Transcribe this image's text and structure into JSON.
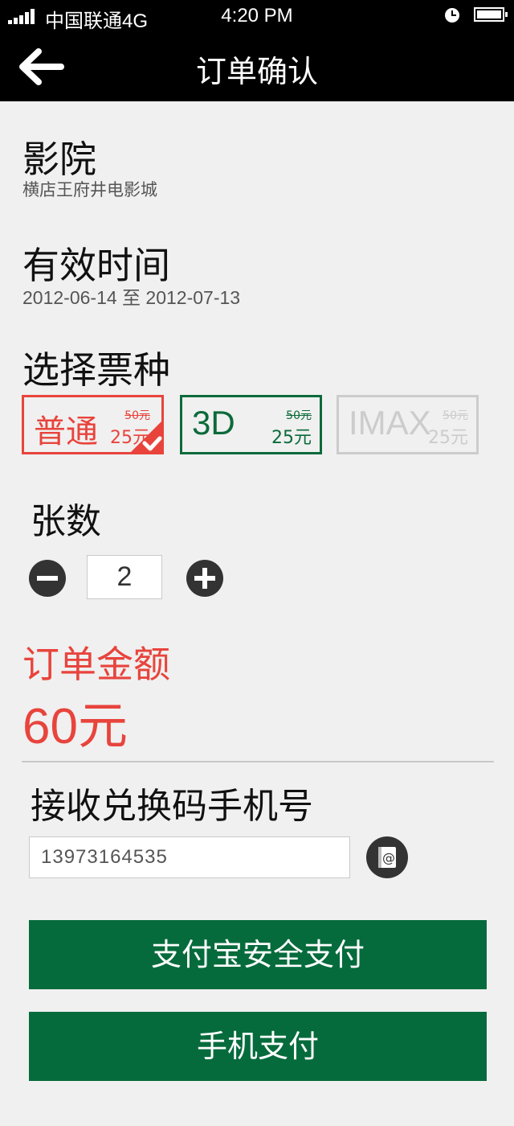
{
  "status_bar": {
    "carrier": "中国联通4G",
    "time": "4:20 PM",
    "alarm_icon": "clock-icon",
    "battery_icon": "battery-icon",
    "signal_icon": "signal-icon"
  },
  "nav": {
    "title": "订单确认",
    "back_icon": "arrow-left-icon"
  },
  "cinema": {
    "label": "影院",
    "value": "横店王府井电影城"
  },
  "validity": {
    "label": "有效时间",
    "value": "2012-06-14 至 2012-07-13"
  },
  "ticket_type": {
    "label": "选择票种",
    "options": [
      {
        "name": "普通",
        "old_price": "50元",
        "price": "25元",
        "selected": true
      },
      {
        "name": "3D",
        "old_price": "50元",
        "price": "25元",
        "selected": false
      },
      {
        "name": "IMAX",
        "old_price": "50元",
        "price": "25元",
        "selected": false,
        "disabled": true
      }
    ]
  },
  "quantity": {
    "label": "张数",
    "value": "2"
  },
  "order_total": {
    "label": "订单金额",
    "value": "60元"
  },
  "phone": {
    "label": "接收兑换码手机号",
    "value": "13973164535",
    "contact_icon": "contact-book-icon"
  },
  "buttons": {
    "alipay": "支付宝安全支付",
    "mobile_pay": "手机支付"
  },
  "colors": {
    "accent_red": "#e8443c",
    "accent_green": "#066b3c",
    "disabled": "#cccccc"
  }
}
